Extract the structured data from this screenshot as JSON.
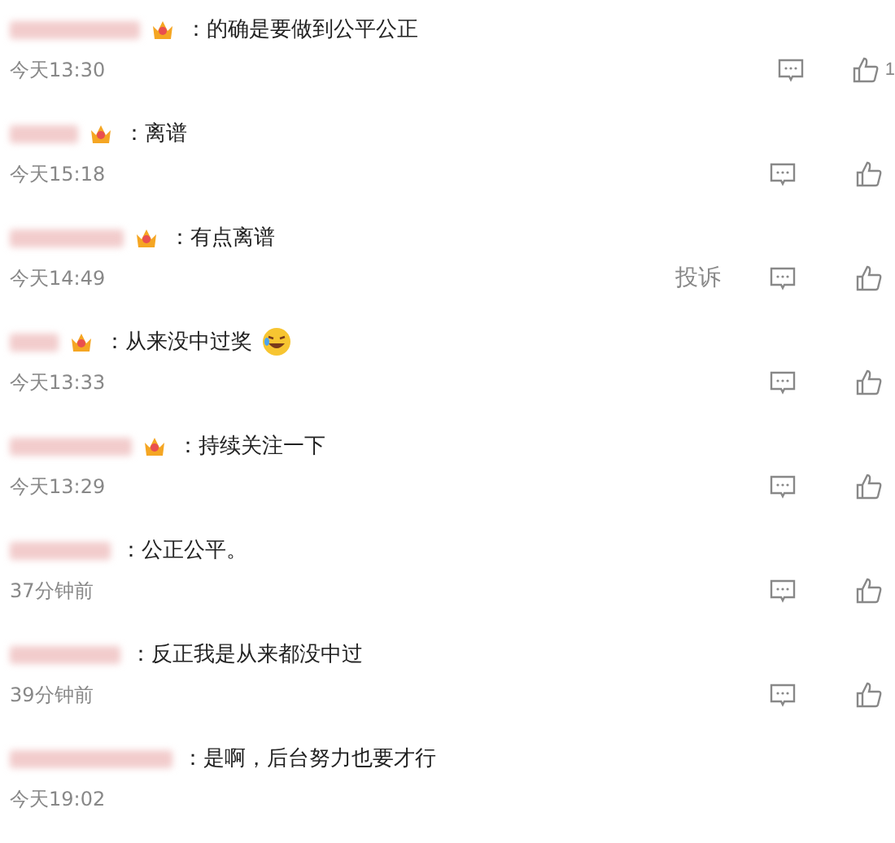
{
  "comments": [
    {
      "badge": true,
      "sep": "：",
      "text": "的确是要做到公平公正",
      "emoji": false,
      "time": "今天13:30",
      "actions": true,
      "likes": "1"
    },
    {
      "badge": true,
      "sep": "：",
      "text": "离谱",
      "emoji": false,
      "time": "今天15:18",
      "actions": true
    },
    {
      "badge": true,
      "sep": "：",
      "text": "有点离谱",
      "emoji": false,
      "time": "今天14:49",
      "actions": true,
      "report": "投诉"
    },
    {
      "badge": true,
      "sep": "：",
      "text": "从来没中过奖",
      "emoji": true,
      "time": "今天13:33",
      "actions": true
    },
    {
      "badge": true,
      "sep": "：",
      "text": "持续关注一下",
      "emoji": false,
      "time": "今天13:29",
      "actions": true
    },
    {
      "badge": false,
      "sep": "：",
      "text": "公正公平。",
      "emoji": false,
      "time": "37分钟前",
      "actions": true
    },
    {
      "badge": false,
      "sep": "：",
      "text": "反正我是从来都没中过",
      "emoji": false,
      "time": "39分钟前",
      "actions": true
    },
    {
      "badge": false,
      "sep": "：",
      "text": "是啊，后台努力也要才行",
      "emoji": false,
      "time": "今天19:02",
      "actions": false
    }
  ]
}
